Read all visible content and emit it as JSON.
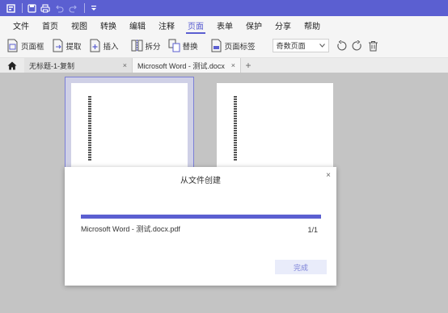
{
  "titlebar": {
    "icons": [
      "app-logo-icon",
      "save-icon",
      "print-icon",
      "undo-icon",
      "redo-icon",
      "quick-access-dropdown-icon"
    ]
  },
  "menu": {
    "items": [
      {
        "label": "文件"
      },
      {
        "label": "首页"
      },
      {
        "label": "视图"
      },
      {
        "label": "转换"
      },
      {
        "label": "编辑"
      },
      {
        "label": "注释"
      },
      {
        "label": "页面",
        "active": true
      },
      {
        "label": "表单"
      },
      {
        "label": "保护"
      },
      {
        "label": "分享"
      },
      {
        "label": "帮助"
      }
    ]
  },
  "toolbar": {
    "page_frame": "页面框",
    "extract": "提取",
    "insert": "插入",
    "split": "拆分",
    "replace": "替换",
    "page_label": "页面标签",
    "page_select": "奇数页面"
  },
  "tabs": {
    "items": [
      {
        "label": "无标题-1-复制",
        "active": false
      },
      {
        "label": "Microsoft Word - 测试.docx",
        "active": true
      }
    ],
    "close_glyph": "×",
    "add_glyph": "+"
  },
  "dialog": {
    "title": "从文件创建",
    "close_glyph": "×",
    "file_name": "Microsoft Word - 测试.docx.pdf",
    "count": "1/1",
    "progress": 1.0,
    "finish_label": "完成"
  },
  "colors": {
    "accent": "#5b5fd1",
    "titlebar": "#5b5fd1",
    "finish_button_bg": "#e9ecfa"
  }
}
